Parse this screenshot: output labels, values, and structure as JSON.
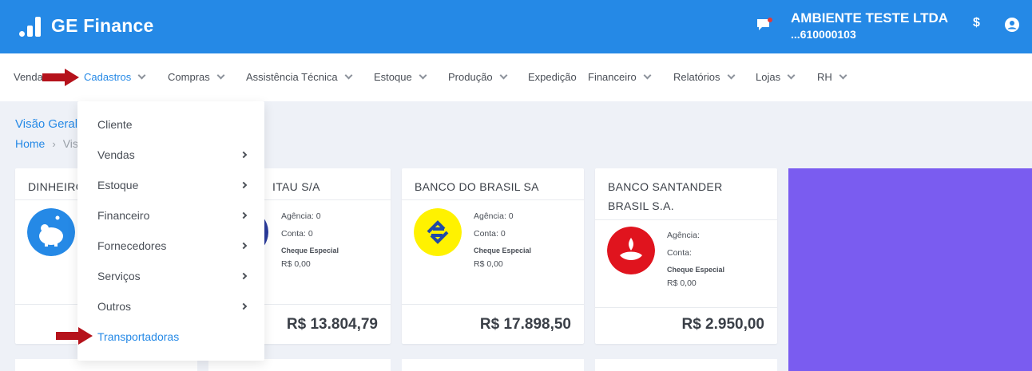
{
  "header": {
    "app_name": "GE Finance",
    "company_name": "AMBIENTE TESTE LTDA",
    "company_id": "...610000103",
    "currency_symbol": "$",
    "colors": {
      "primary": "#2589e6",
      "notification": "#e53935"
    }
  },
  "menu": {
    "items": [
      {
        "label": "Vendas"
      },
      {
        "label": "Cadastros"
      },
      {
        "label": "Compras"
      },
      {
        "label": "Assistência Técnica"
      },
      {
        "label": "Estoque"
      },
      {
        "label": "Produção"
      },
      {
        "label": "Expedição"
      },
      {
        "label": "Financeiro"
      },
      {
        "label": "Relatórios"
      },
      {
        "label": "Lojas"
      },
      {
        "label": "RH"
      }
    ]
  },
  "dropdown": {
    "items": [
      {
        "label": "Cliente"
      },
      {
        "label": "Vendas"
      },
      {
        "label": "Estoque"
      },
      {
        "label": "Financeiro"
      },
      {
        "label": "Fornecedores"
      },
      {
        "label": "Serviços"
      },
      {
        "label": "Outros"
      },
      {
        "label": "Transportadoras"
      }
    ]
  },
  "page": {
    "title": "Visão Geral",
    "breadcrumb_home": "Home",
    "breadcrumb_current": "Visão Geral"
  },
  "cards": [
    {
      "name": "DINHEIRO",
      "balance": ""
    },
    {
      "name": "ITAU S/A",
      "agencia": "Agência: 0",
      "conta": "Conta: 0",
      "cheque": "Cheque Especial",
      "cheque_value": "R$ 0,00",
      "balance": "R$ 13.804,79"
    },
    {
      "name": "BANCO DO BRASIL SA",
      "agencia": "Agência: 0",
      "conta": "Conta: 0",
      "cheque": "Cheque Especial",
      "cheque_value": "R$ 0,00",
      "balance": "R$ 17.898,50"
    },
    {
      "name": "BANCO SANTANDER BRASIL S.A.",
      "agencia": "Agência:",
      "conta": "Conta:",
      "cheque": "Cheque Especial",
      "cheque_value": "R$ 0,00",
      "balance": "R$ 2.950,00"
    }
  ]
}
